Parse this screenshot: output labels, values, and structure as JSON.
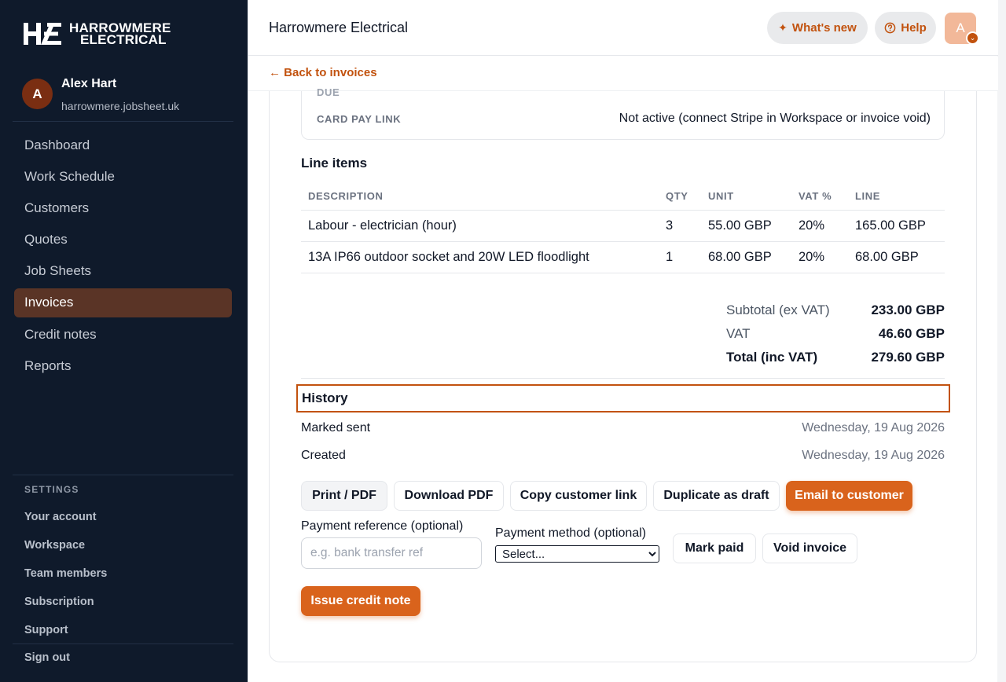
{
  "sidebar": {
    "logo_line1": "HARROWMERE",
    "logo_line2": "ELECTRICAL",
    "user": {
      "initial": "A",
      "name": "Alex Hart",
      "domain": "harrowmere.jobsheet.uk"
    },
    "nav": [
      "Dashboard",
      "Work Schedule",
      "Customers",
      "Quotes",
      "Job Sheets",
      "Invoices",
      "Credit notes",
      "Reports"
    ],
    "active_nav": "Invoices",
    "settings_heading": "SETTINGS",
    "settings": [
      "Your account",
      "Workspace",
      "Team members",
      "Subscription",
      "Support"
    ],
    "sign_out": "Sign out"
  },
  "topbar": {
    "title": "Harrowmere Electrical",
    "whats_new": "What's new",
    "help": "Help",
    "avatar_initial": "A"
  },
  "back_link": "← Back to invoices",
  "info": {
    "due_label": "DUE",
    "card_pay_label": "CARD PAY LINK",
    "card_pay_value": "Not active (connect Stripe in Workspace or invoice void)"
  },
  "line_items": {
    "title": "Line items",
    "headers": [
      "DESCRIPTION",
      "QTY",
      "UNIT",
      "VAT %",
      "LINE"
    ],
    "rows": [
      [
        "Labour - electrician (hour)",
        "3",
        "55.00 GBP",
        "20%",
        "165.00 GBP"
      ],
      [
        "13A IP66 outdoor socket and 20W LED floodlight",
        "1",
        "68.00 GBP",
        "20%",
        "68.00 GBP"
      ]
    ]
  },
  "totals": {
    "subtotal_label": "Subtotal (ex VAT)",
    "subtotal": "233.00 GBP",
    "vat_label": "VAT",
    "vat": "46.60 GBP",
    "total_label": "Total (inc VAT)",
    "total": "279.60 GBP"
  },
  "history": {
    "title": "History",
    "events": [
      {
        "label": "Marked sent",
        "date": "Wednesday, 19 Aug 2026"
      },
      {
        "label": "Created",
        "date": "Wednesday, 19 Aug 2026"
      }
    ]
  },
  "actions": {
    "print": "Print / PDF",
    "download": "Download PDF",
    "copy_link": "Copy customer link",
    "duplicate": "Duplicate as draft",
    "email": "Email to customer",
    "mark_paid": "Mark paid",
    "void": "Void invoice",
    "credit_note": "Issue credit note"
  },
  "payment": {
    "reference_label": "Payment reference (optional)",
    "reference_placeholder": "e.g. bank transfer ref",
    "method_label": "Payment method (optional)",
    "method_selected": "Select..."
  },
  "colors": {
    "accent": "#d9631c",
    "sidebar_bg": "#0f1a2b",
    "active_nav_bg": "#5a3426"
  }
}
